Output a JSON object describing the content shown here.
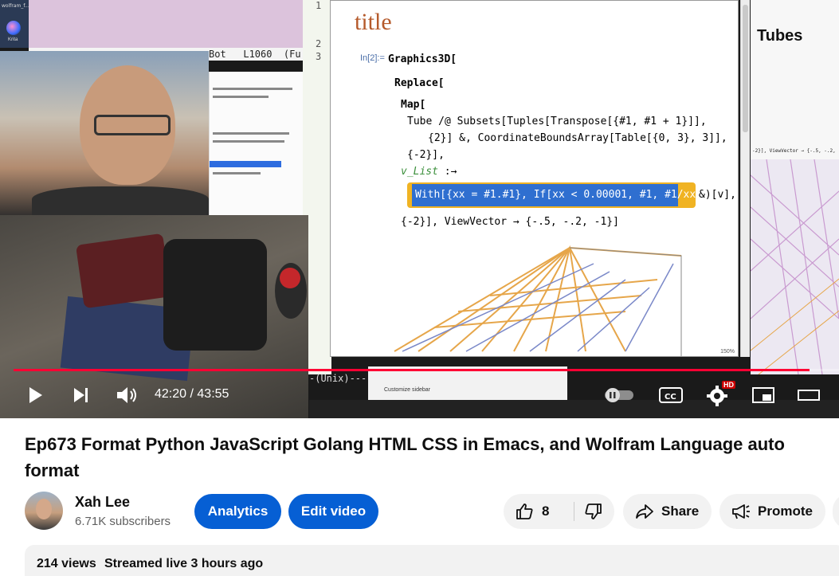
{
  "video": {
    "desktop_label": "wolfram_f...",
    "krita_label": "Krita",
    "emacs_status": "Bot   L1060  (Fu",
    "editor_line_numbers": [
      "1",
      "2",
      "3"
    ],
    "notebook": {
      "title": "title",
      "input_label": "In[2]:=",
      "code_lines": [
        "Graphics3D[",
        "Replace[",
        "Map[",
        "Tube /@ Subsets[Tuples[Transpose[{#1, #1 + 1}]],",
        "{2}] &, CoordinateBoundsArray[Table[{0, 3}, 3]],",
        "{-2}],",
        "{-2}], ViewVector → {-.5, -.2, -1}]"
      ],
      "pattern_var": "v_List",
      "rule_arrow": ":→",
      "highlighted_code": "With[{xx = #1.#1}, If[xx < 0.00001, #1, #1/xx]]",
      "after_highlight": "&)[v],",
      "zoom": "150%"
    },
    "right_panel_title": "Tubes",
    "right_panel_snippet": "-2}], ViewVector → {-.5, -.2,",
    "unix_mode": "-(Unix)---",
    "side_menu_item": "Customize sidebar",
    "time_current": "42:20",
    "time_separator": "/",
    "time_total": "43:55",
    "progress_fraction": 0.964,
    "hd_badge": "HD",
    "colors": {
      "progress": "#ff0033",
      "hd": "#cc0000"
    }
  },
  "info": {
    "title": "Ep673 Format Python JavaScript Golang HTML CSS in Emacs, and Wolfram Language auto format",
    "channel_name": "Xah Lee",
    "subscribers": "6.71K subscribers",
    "analytics_label": "Analytics",
    "edit_label": "Edit video",
    "like_count": "8",
    "share_label": "Share",
    "promote_label": "Promote",
    "views": "214 views",
    "streamed": "Streamed live 3 hours ago",
    "colors": {
      "primary_button": "#065fd4",
      "pill": "#f2f2f2"
    }
  }
}
